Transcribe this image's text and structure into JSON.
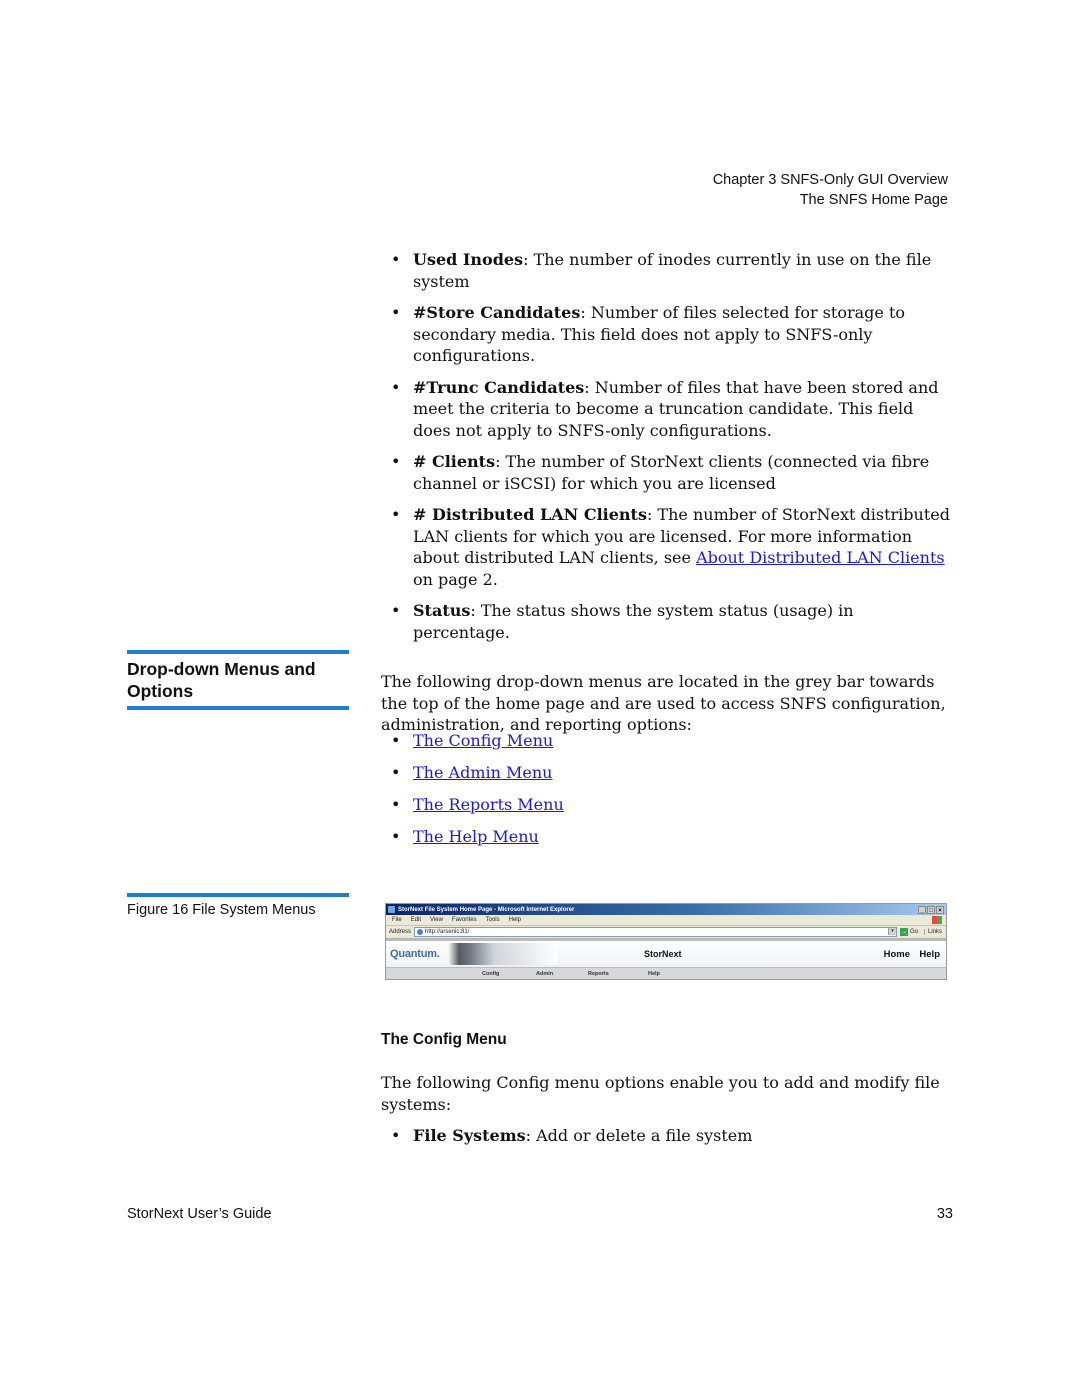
{
  "running_header": {
    "chapter": "Chapter 3  SNFS-Only GUI Overview",
    "section": "The SNFS Home Page"
  },
  "field_descriptions": [
    {
      "term": "Used Inodes",
      "text": ": The number of inodes currently in use on the file system"
    },
    {
      "term": "#Store Candidates",
      "text": ": Number of files selected for storage to secondary media. This field does not apply to SNFS-only configurations."
    },
    {
      "term": "#Trunc Candidates",
      "text": ": Number of files that have been stored and meet the criteria to become a truncation candidate. This field does not apply to SNFS-only configurations."
    },
    {
      "term": "# Clients",
      "text": ": The number of StorNext clients (connected via fibre channel or iSCSI) for which you are licensed"
    },
    {
      "term": "# Distributed LAN Clients",
      "text": ": The number of StorNext distributed LAN clients for which you are licensed. For more information about distributed LAN clients, see ",
      "link": "About Distributed LAN Clients",
      "after": " on page  2."
    },
    {
      "term": "Status",
      "text": ": The status shows the system status (usage) in percentage."
    }
  ],
  "dropdown_section": {
    "heading": "Drop-down Menus and Options",
    "intro": "The following drop-down menus are located in the grey bar towards the top of the home page and are used to access SNFS configuration, administration, and reporting options:",
    "links": [
      "The Config Menu",
      "The Admin Menu",
      "The Reports Menu",
      "The Help Menu"
    ]
  },
  "figure": {
    "caption": "Figure 16  File System Menus",
    "browser": {
      "window_title": "StorNext File System Home Page - Microsoft Internet Explorer",
      "menu": [
        "File",
        "Edit",
        "View",
        "Favorites",
        "Tools",
        "Help"
      ],
      "address_label": "Address",
      "address_value": "http://arsenic:81/",
      "go_label": "Go",
      "links_label": "Links",
      "window_buttons": [
        "_",
        "□",
        "×"
      ],
      "brand": "Quantum.",
      "product": "StorNext",
      "home_link": "Home",
      "help_link": "Help",
      "nav": [
        "Config",
        "Admin",
        "Reports",
        "Help"
      ]
    }
  },
  "config_section": {
    "heading": "The Config Menu",
    "intro": "The following Config menu options enable you to add and modify file systems:",
    "items": [
      {
        "term": "File Systems",
        "text": ": Add or delete a file system"
      }
    ]
  },
  "footer": {
    "title": "StorNext User’s Guide",
    "page": "33"
  },
  "colors": {
    "rule": "#1e7fc6",
    "link": "#1a1adc"
  },
  "bullet": "•"
}
